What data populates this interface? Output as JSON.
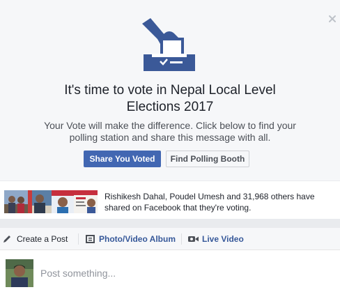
{
  "promo": {
    "close_icon": "close-icon",
    "hero_icon": "ballot-box-icon",
    "headline_line1": "It's time to vote in Nepal Local Level",
    "headline_line2": "Elections 2017",
    "subtext_line1": "Your Vote will make the difference. Click below to find your",
    "subtext_line2": "polling station and share this message with all.",
    "share_button": "Share You Voted",
    "find_button": "Find Polling Booth"
  },
  "social_proof": {
    "line1": "Rishikesh Dahal, Poudel Umesh and 31,968 others have",
    "line2": "shared on Facebook that they're voting."
  },
  "composer": {
    "tabs": [
      {
        "label": "Create a Post",
        "icon": "pencil-icon"
      },
      {
        "label": "Photo/Video Album",
        "icon": "photo-album-icon"
      },
      {
        "label": "Live Video",
        "icon": "video-camera-icon"
      }
    ],
    "placeholder": "Post something..."
  },
  "colors": {
    "brand_blue": "#4267b2",
    "link_blue": "#365899",
    "background": "#f6f7f9"
  }
}
